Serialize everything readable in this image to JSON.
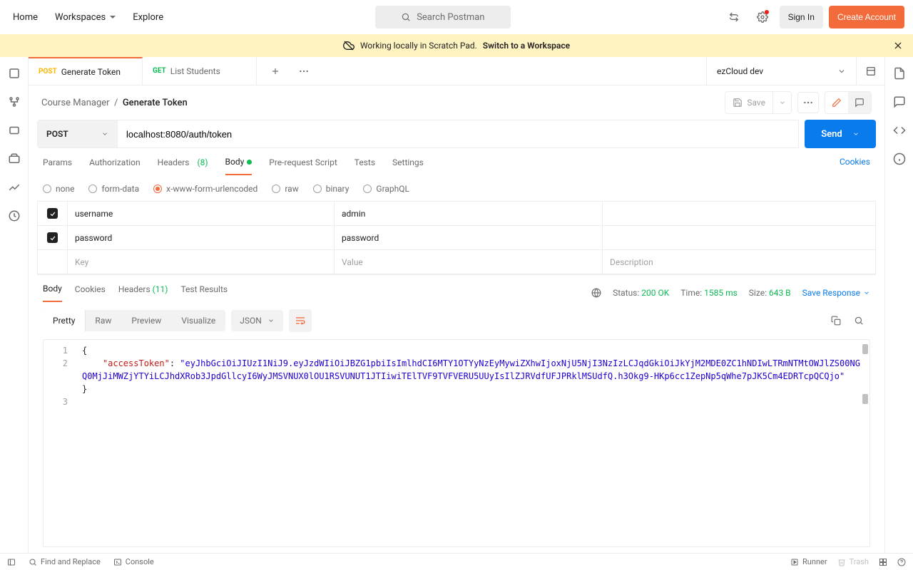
{
  "topnav": {
    "home": "Home",
    "workspaces": "Workspaces",
    "explore": "Explore",
    "search_placeholder": "Search Postman",
    "signin": "Sign In",
    "create": "Create Account"
  },
  "banner": {
    "text": "Working locally in Scratch Pad.",
    "link": "Switch to a Workspace"
  },
  "tabs": [
    {
      "method": "POST",
      "name": "Generate Token",
      "active": true
    },
    {
      "method": "GET",
      "name": "List Students",
      "active": false
    }
  ],
  "environment": "ezCloud dev",
  "breadcrumb": {
    "collection": "Course Manager",
    "request": "Generate Token"
  },
  "save_label": "Save",
  "request": {
    "method": "POST",
    "url": "localhost:8080/auth/token",
    "send": "Send"
  },
  "reqtabs": {
    "params": "Params",
    "auth": "Authorization",
    "headers": "Headers",
    "headers_count": "(8)",
    "body": "Body",
    "prerequest": "Pre-request Script",
    "tests": "Tests",
    "settings": "Settings",
    "cookies": "Cookies"
  },
  "bodytypes": {
    "none": "none",
    "formdata": "form-data",
    "urlencoded": "x-www-form-urlencoded",
    "raw": "raw",
    "binary": "binary",
    "graphql": "GraphQL"
  },
  "kv": {
    "rows": [
      {
        "key": "username",
        "value": "admin"
      },
      {
        "key": "password",
        "value": "password"
      }
    ],
    "ph_key": "Key",
    "ph_value": "Value",
    "ph_desc": "Description"
  },
  "resptabs": {
    "body": "Body",
    "cookies": "Cookies",
    "headers": "Headers",
    "headers_count": "(11)",
    "tests": "Test Results"
  },
  "resp_meta": {
    "status_label": "Status:",
    "status": "200 OK",
    "time_label": "Time:",
    "time": "1585 ms",
    "size_label": "Size:",
    "size": "643 B",
    "save": "Save Response"
  },
  "viewtabs": {
    "pretty": "Pretty",
    "raw": "Raw",
    "preview": "Preview",
    "visualize": "Visualize",
    "format": "JSON"
  },
  "response_json": {
    "line1": "{",
    "key": "\"accessToken\"",
    "colon": ": ",
    "value": "\"eyJhbGciOiJIUzI1NiJ9.eyJzdWIiOiJBZG1pbiIsImlhdCI6MTY1OTYyNzEyMywiZXhwIjoxNjU5NjI3NzIzLCJqdGkiOiJkYjM2MDE0ZC1hNDIwLTRmNTMtOWJlZS00NGQ0MjJiMWZjYTYiLCJhdXRob3JpdGllcyI6WyJMSVNUX0lOU1RSVUNUT1JTIiwiTElTVF9TVFVERU5UUyIsIlZJRVdfUFJPRklMSUdfQ.h3Okg9-HKp6cc1ZepNp5qWhe7pJK5Cm4EDRTcpQCQjo\"",
    "line3": "}"
  },
  "footer": {
    "find": "Find and Replace",
    "console": "Console",
    "runner": "Runner",
    "trash": "Trash"
  }
}
